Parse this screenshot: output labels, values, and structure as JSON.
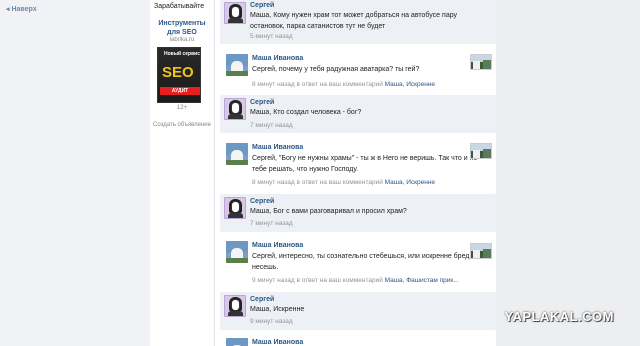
{
  "scroll_up": "Наверх",
  "ad": {
    "earn_label": "Зарабатывайте",
    "title": "Инструменты для SEO",
    "site": "labrika.ru",
    "image_new": "Новый сервис",
    "image_seo": "SEO",
    "image_audit": "АУДИТ",
    "age": "12+",
    "create": "Создать объявление"
  },
  "comments": [
    {
      "author": "Сергей",
      "text": "Маша, Кому нужен храм тот может добраться на автобусе пару остановок, парка сатанистов тут не будет",
      "time": "5 минут назад",
      "reply": "",
      "reply_to": ""
    },
    {
      "author": "Маша Иванова",
      "text": "Сергей, почему у тебя радужная аватарка? ты гей?",
      "time": "8 минут назад в ответ на ваш комментарий",
      "reply": "Маша, Искренне",
      "reply_to": ""
    },
    {
      "author": "Сергей",
      "text": "Маша, Кто создал человека - бог?",
      "time": "7 минут назад",
      "reply": "",
      "reply_to": ""
    },
    {
      "author": "Маша Иванова",
      "text": "Сергей, \"Богу не нужны храмы\" - ты ж в Него не веришь. Так что и не тебе решать, что нужно Господу.",
      "time": "8 минут назад в ответ на ваш комментарий",
      "reply": "Маша, Искренне",
      "reply_to": ""
    },
    {
      "author": "Сергей",
      "text": "Маша, Бог с вами разговаривал и просил храм?",
      "time": "7 минут назад",
      "reply": "",
      "reply_to": ""
    },
    {
      "author": "Маша Иванова",
      "text": "Сергей, интересно, ты сознательно стебешься, или искренне бред несешь.",
      "time": "9 минут назад в ответ на ваш комментарий",
      "reply": "Маша, Фашистам прик...",
      "reply_to": ""
    },
    {
      "author": "Сергей",
      "text": "Маша, Искренне",
      "time": "9 минут назад",
      "reply": "",
      "reply_to": ""
    },
    {
      "author": "Маша Иванова",
      "text": "",
      "time": "",
      "reply": "",
      "reply_to": ""
    }
  ],
  "watermark": "YAPLAKAL.COM"
}
